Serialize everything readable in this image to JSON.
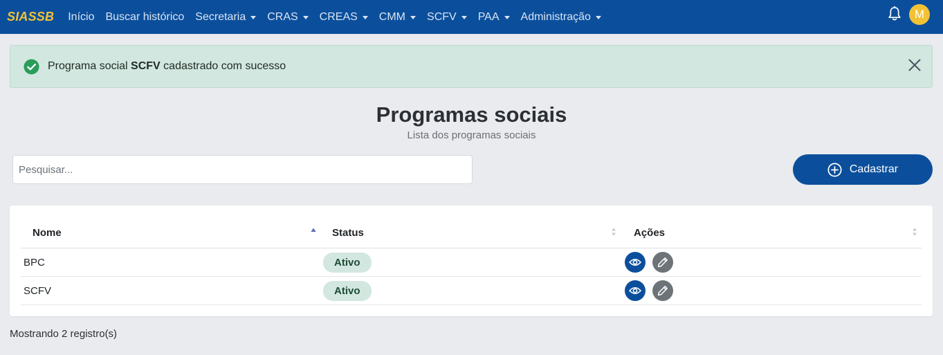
{
  "navbar": {
    "brand": "SIASSB",
    "items": [
      {
        "label": "Início",
        "dropdown": false
      },
      {
        "label": "Buscar histórico",
        "dropdown": false
      },
      {
        "label": "Secretaria",
        "dropdown": true
      },
      {
        "label": "CRAS",
        "dropdown": true
      },
      {
        "label": "CREAS",
        "dropdown": true
      },
      {
        "label": "CMM",
        "dropdown": true
      },
      {
        "label": "SCFV",
        "dropdown": true
      },
      {
        "label": "PAA",
        "dropdown": true
      },
      {
        "label": "Administração",
        "dropdown": true
      }
    ],
    "avatar_initial": "M",
    "bell_icon": "bell-icon"
  },
  "alert": {
    "prefix": "Programa social ",
    "name": "SCFV",
    "suffix": " cadastrado com sucesso",
    "icon": "check-circle-icon",
    "close_icon": "close-icon"
  },
  "page": {
    "title": "Programas sociais",
    "subtitle": "Lista dos programas sociais"
  },
  "search": {
    "placeholder": "Pesquisar...",
    "value": ""
  },
  "toolbar": {
    "add_label": "Cadastrar",
    "add_icon": "plus-circle-icon"
  },
  "table": {
    "columns": [
      {
        "label": "Nome",
        "sort": "ascending"
      },
      {
        "label": "Status",
        "sort": "none"
      },
      {
        "label": "Ações",
        "sort": "none"
      }
    ],
    "rows": [
      {
        "nome": "BPC",
        "status": "Ativo"
      },
      {
        "nome": "SCFV",
        "status": "Ativo"
      }
    ]
  },
  "footer": {
    "count_text": "Mostrando 2 registro(s)"
  },
  "colors": {
    "navbar": "#0b4f9c",
    "brand": "#f2c236",
    "alert_bg": "#d2e7df",
    "success": "#2a9d5c",
    "view_button": "#0b4f9c",
    "edit_button": "#6d7479"
  }
}
